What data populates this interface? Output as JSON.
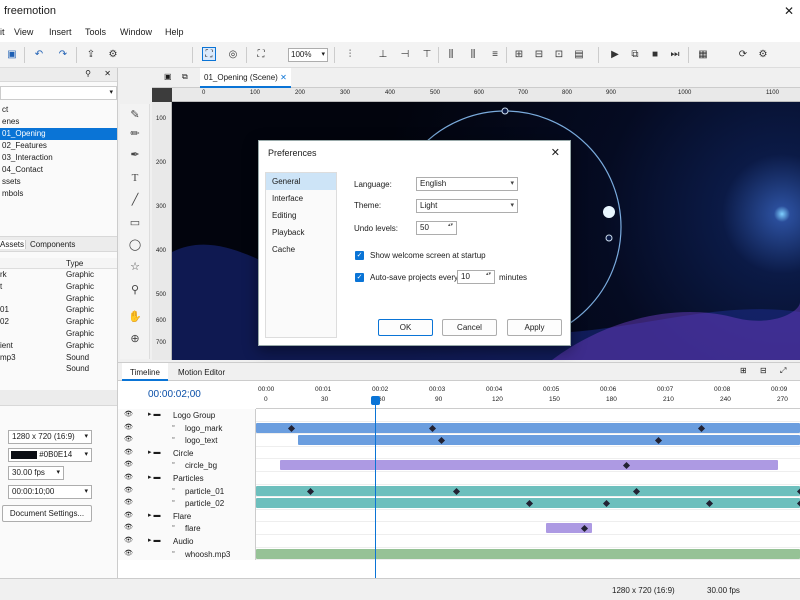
{
  "app": {
    "title": "freemotion"
  },
  "menu": [
    "it",
    "View",
    "Insert",
    "Tools",
    "Window",
    "Help"
  ],
  "toolbar": {
    "zoom": "100%"
  },
  "project": {
    "items": [
      "ct",
      "enes",
      "01_Opening",
      "02_Features",
      "03_Interaction",
      "04_Contact",
      "ssets",
      "mbols"
    ]
  },
  "assets_tabs": [
    "Assets",
    "Components"
  ],
  "assets": {
    "header": [
      "",
      "Type"
    ],
    "rows": [
      [
        "rk",
        "Graphic"
      ],
      [
        "t",
        "Graphic"
      ],
      [
        "",
        "Graphic"
      ],
      [
        "01",
        "Graphic"
      ],
      [
        "02",
        "Graphic"
      ],
      [
        "",
        "Graphic"
      ],
      [
        "ient",
        "Graphic"
      ],
      [
        "mp3",
        "Sound"
      ],
      [
        "",
        "Sound"
      ]
    ]
  },
  "doc": {
    "resolution": "1280 x 720 (16:9)",
    "bg_color": "#0B0E14",
    "fps": "30.00 fps",
    "duration": "00:00:10;00",
    "settings_button": "Document Settings..."
  },
  "tab": {
    "label": "01_Opening (Scene)"
  },
  "ruler_h": [
    "0",
    "100",
    "200",
    "300",
    "400",
    "500",
    "600",
    "700",
    "800",
    "900",
    "1000",
    "1100"
  ],
  "ruler_v": [
    "100",
    "200",
    "300",
    "400",
    "500",
    "600",
    "700"
  ],
  "dialog": {
    "title": "Preferences",
    "nav": [
      "General",
      "Interface",
      "Editing",
      "Playback",
      "Cache"
    ],
    "language_label": "Language:",
    "language": "English",
    "theme_label": "Theme:",
    "theme": "Light",
    "undo_label": "Undo levels:",
    "undo": "50",
    "welcome": "Show welcome screen at startup",
    "autosave": "Auto-save projects every",
    "autosave_val": "10",
    "minutes": "minutes",
    "ok": "OK",
    "cancel": "Cancel",
    "apply": "Apply"
  },
  "timeline": {
    "tabs": [
      "Timeline",
      "Motion Editor"
    ],
    "time": "00:00:02;00",
    "ruler_time": [
      "00:00",
      "00:01",
      "00:02",
      "00:03",
      "00:04",
      "00:05",
      "00:06",
      "00:07",
      "00:08",
      "00:09"
    ],
    "ruler_frames": [
      "0",
      "30",
      "60",
      "90",
      "120",
      "150",
      "180",
      "210",
      "240",
      "270"
    ],
    "layers": [
      "Logo Group",
      "logo_mark",
      "logo_text",
      "Circle",
      "circle_bg",
      "Particles",
      "particle_01",
      "particle_02",
      "Flare",
      "flare",
      "Audio",
      "whoosh.mp3"
    ]
  },
  "status": {
    "resolution": "1280 x 720 (16:9)",
    "fps": "30.00 fps"
  },
  "colors": {
    "accent": "#0A74D6",
    "logo_bar": "#5B93DC",
    "purple": "#A48FE0",
    "teal": "#5DB8B6",
    "audio": "#6AA86A"
  }
}
